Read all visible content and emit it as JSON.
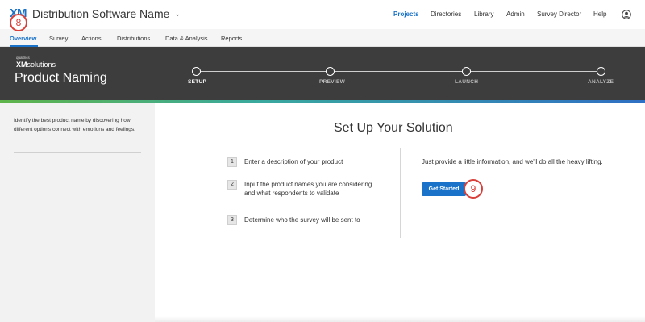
{
  "app": {
    "logo_text": "XM",
    "title": "Distribution Software Name"
  },
  "topnav": {
    "items": [
      "Projects",
      "Directories",
      "Library",
      "Admin",
      "Survey Director",
      "Help"
    ],
    "active": "Projects",
    "accent_color": "#1a73c8"
  },
  "subnav": {
    "tabs": [
      "Overview",
      "Survey",
      "Actions",
      "Distributions",
      "Data & Analysis",
      "Reports"
    ],
    "active": "Overview"
  },
  "markers": {
    "first": "8",
    "second": "9"
  },
  "hero": {
    "brand_small": "qualtrics",
    "brand_xm": "XM",
    "brand_solutions": "solutions",
    "title": "Product Naming",
    "steps": [
      "SETUP",
      "PREVIEW",
      "LAUNCH",
      "ANALYZE"
    ],
    "active_step": "SETUP"
  },
  "sidebar": {
    "description": "Identify the best product name by discovering how different options connect with emotions and feelings."
  },
  "main": {
    "title": "Set Up Your Solution",
    "steps": [
      {
        "num": "1",
        "text": "Enter a description of your product"
      },
      {
        "num": "2",
        "text": "Input the product names you are considering and what respondents to validate"
      },
      {
        "num": "3",
        "text": "Determine who the survey will be sent to"
      }
    ],
    "info": "Just provide a little information, and we'll do all the heavy lifting.",
    "button_label": "Get Started"
  }
}
